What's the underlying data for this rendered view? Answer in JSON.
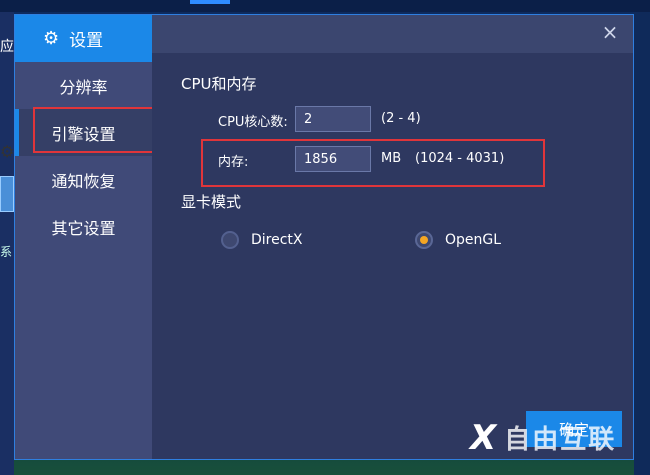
{
  "background": {
    "left_text_top": "应",
    "left_text_bottom": "系",
    "accent": "#1b88e8"
  },
  "dialog": {
    "header": {
      "title": "设置",
      "icon": "gear-icon"
    },
    "sidebar_items": [
      {
        "label": "分辨率",
        "active": false
      },
      {
        "label": "引擎设置",
        "active": true
      },
      {
        "label": "通知恢复",
        "active": false
      },
      {
        "label": "其它设置",
        "active": false
      }
    ],
    "close_icon": "×",
    "cpu_section": {
      "title": "CPU和内存",
      "cpu_label": "CPU核心数:",
      "cpu_value": "2",
      "cpu_range": "(2 - 4)",
      "memory_label": "内存:",
      "memory_value": "1856",
      "memory_unit": "MB",
      "memory_range": "(1024 - 4031)"
    },
    "gpu_section": {
      "title": "显卡模式",
      "options": [
        {
          "label": "DirectX",
          "checked": false
        },
        {
          "label": "OpenGL",
          "checked": true
        }
      ]
    },
    "ok_button": "确定"
  },
  "watermark": {
    "mark": "X",
    "text": "自由互联"
  },
  "colors": {
    "highlight_border": "#e0353a",
    "radio_selected": "#f5a623"
  }
}
